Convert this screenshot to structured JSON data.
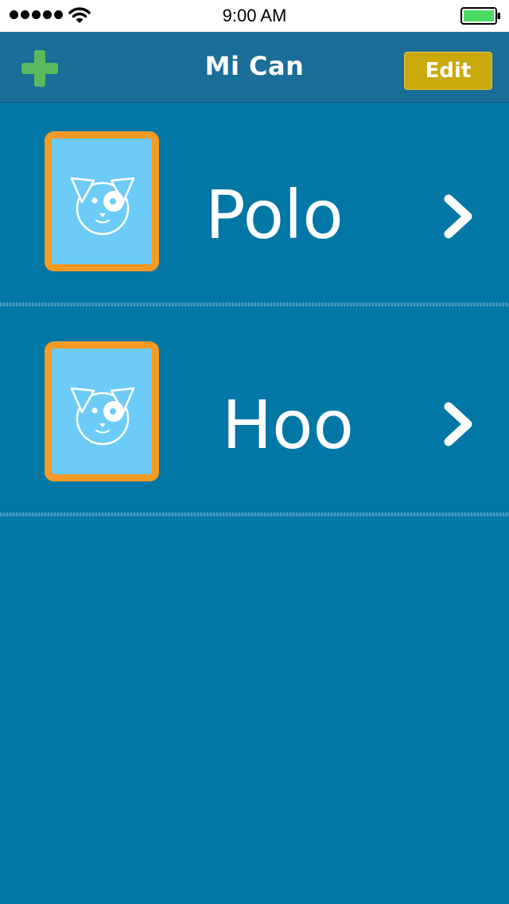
{
  "status_bar": {
    "time": "9:00 AM",
    "signal_icon": "signal-dots-icon",
    "wifi_icon": "wifi-icon",
    "battery_icon": "battery-icon"
  },
  "nav": {
    "title": "Mi Can",
    "add_icon": "plus-icon",
    "edit_label": "Edit"
  },
  "pets": [
    {
      "name": "Polo",
      "avatar_icon": "dog-face-icon",
      "chevron_icon": "chevron-right-icon"
    },
    {
      "name": "Hoo",
      "avatar_icon": "dog-face-icon",
      "chevron_icon": "chevron-right-icon"
    }
  ],
  "colors": {
    "background": "#0177a6",
    "nav_bar": "#1a6e97",
    "edit_button": "#c9a90b",
    "add_icon": "#5cb85c",
    "avatar_border": "#f59a24",
    "avatar_fill": "#6dccf7",
    "battery": "#4cd964"
  }
}
